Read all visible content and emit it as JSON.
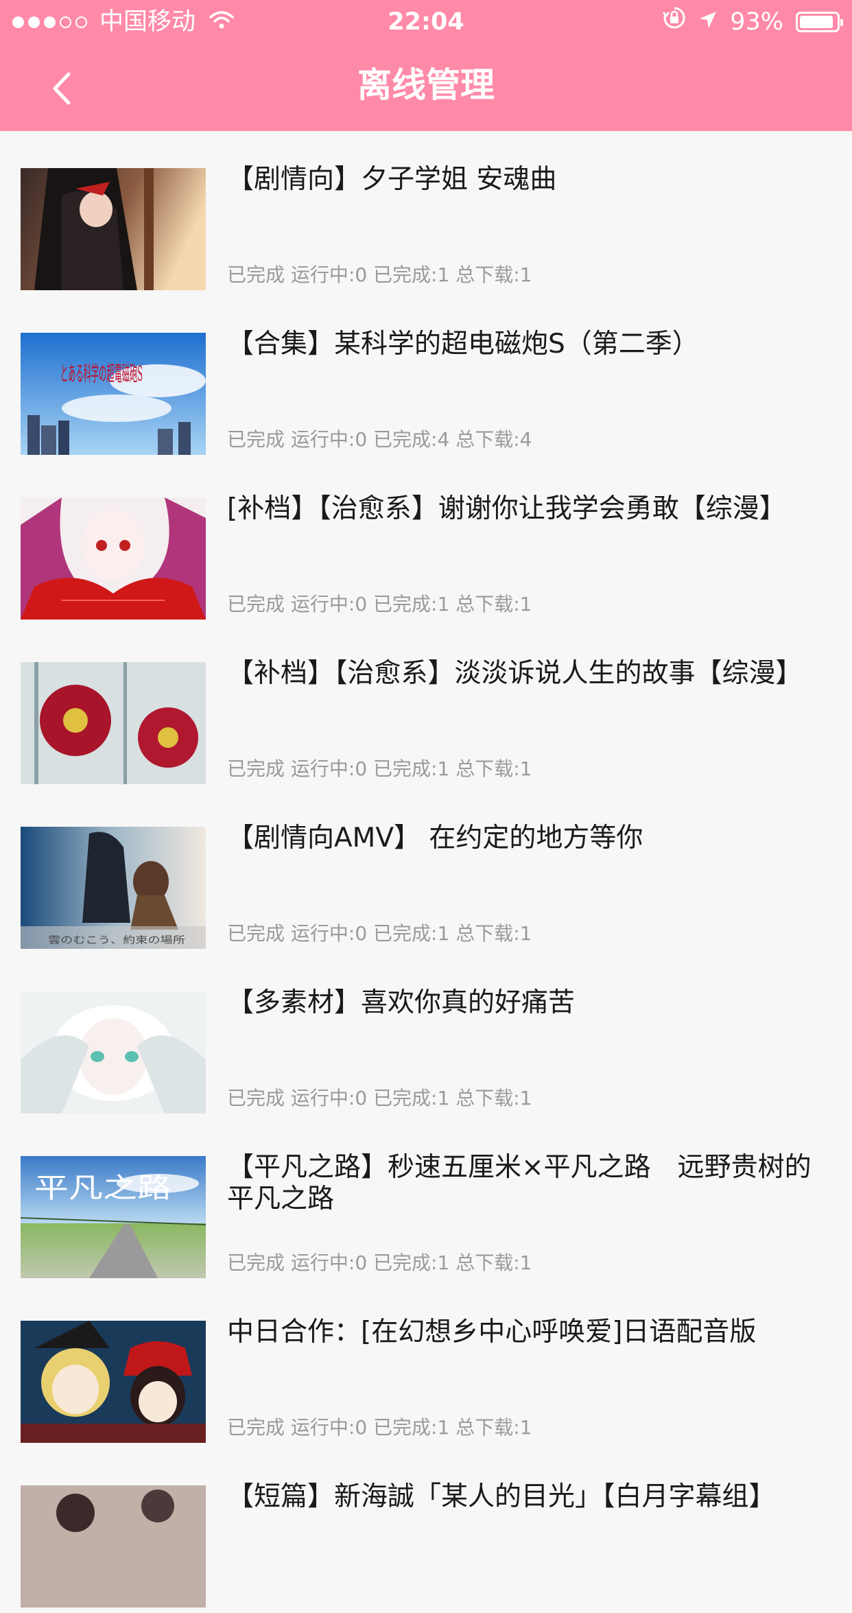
{
  "status_bar": {
    "carrier": "中国移动",
    "time": "22:04",
    "battery": "93%",
    "battery_level": 0.93
  },
  "nav": {
    "title": "离线管理",
    "back_icon": "chevron-left-icon"
  },
  "items": [
    {
      "title": "【剧情向】夕子学姐 安魂曲",
      "status": "已完成 运行中:0 已完成:1 总下载:1"
    },
    {
      "title": "【合集】某科学的超电磁炮S（第二季）",
      "status": "已完成 运行中:0 已完成:4 总下载:4"
    },
    {
      "title": "[补档】【治愈系】谢谢你让我学会勇敢【综漫】",
      "status": "已完成 运行中:0 已完成:1 总下载:1"
    },
    {
      "title": "【补档】【治愈系】淡淡诉说人生的故事【综漫】",
      "status": "已完成 运行中:0 已完成:1 总下载:1"
    },
    {
      "title": "【剧情向AMV】 在约定的地方等你",
      "status": "已完成 运行中:0 已完成:1 总下载:1"
    },
    {
      "title": "【多素材】喜欢你真的好痛苦",
      "status": "已完成 运行中:0 已完成:1 总下载:1"
    },
    {
      "title": "【平凡之路】秒速五厘米×平凡之路　远野贵树的平凡之路",
      "status": "已完成 运行中:0 已完成:1 总下载:1"
    },
    {
      "title": "中日合作：[在幻想乡中心呼唤爱]日语配音版",
      "status": "已完成 运行中:0 已完成:1 总下载:1"
    },
    {
      "title": "【短篇】新海誠「某人的目光」【白月字幕组】",
      "status": ""
    }
  ],
  "thumb_text": {
    "item2": "とある科学の超電磁砲S",
    "item5": "雲のむこう、約束の場所",
    "item7": "平凡之路"
  },
  "colors": {
    "header": "#ff8aa8",
    "background": "#f7f7f7",
    "title_text": "#1a1a1a",
    "status_text": "#9a9a9a"
  }
}
